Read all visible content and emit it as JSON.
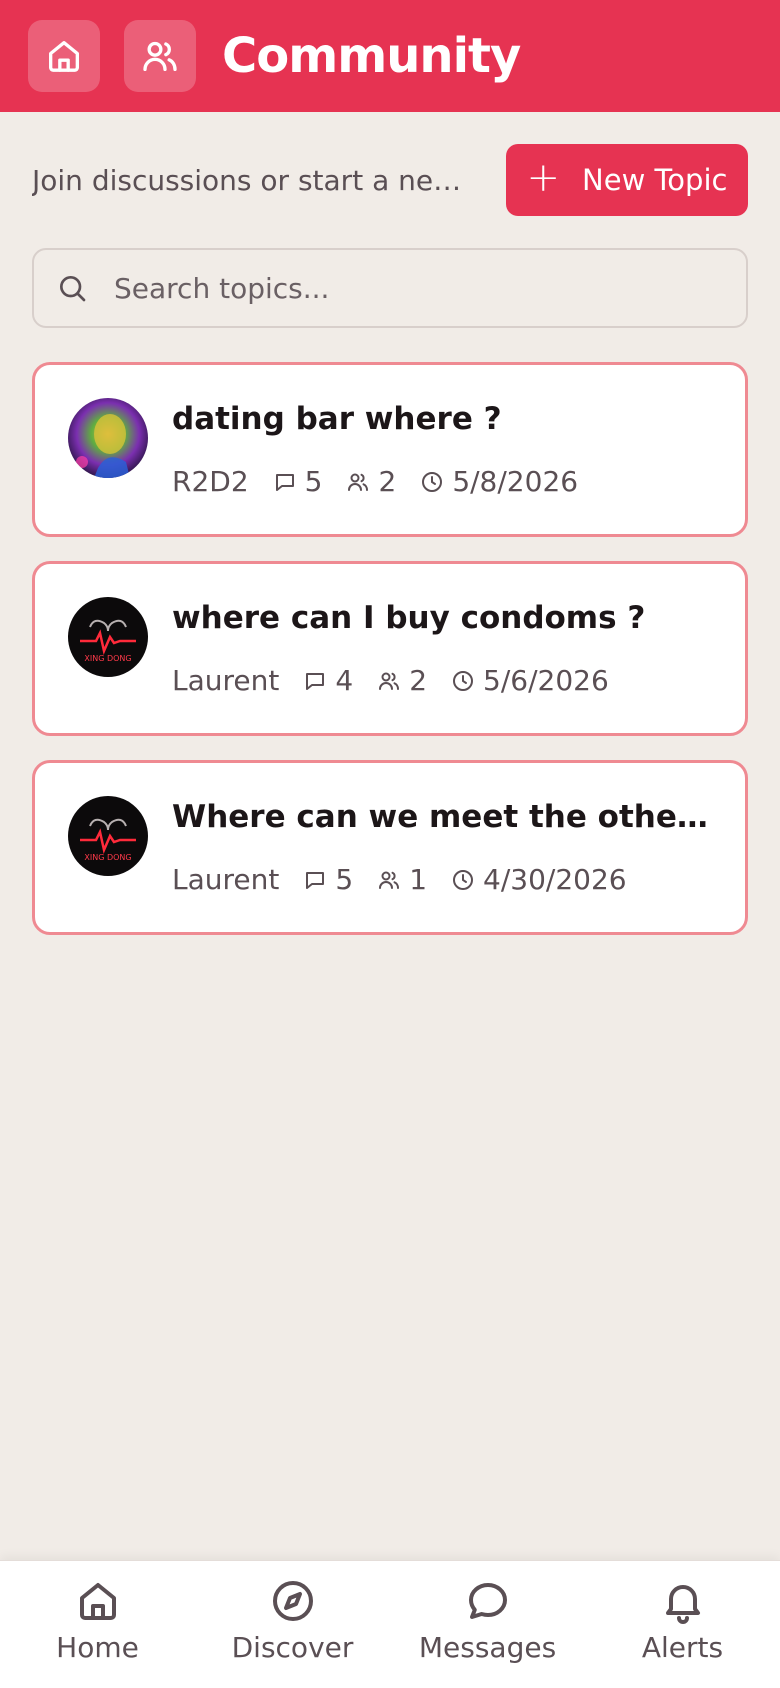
{
  "header": {
    "title": "Community",
    "accent": "#e63352",
    "home_icon": "home-icon",
    "users_icon": "users-icon"
  },
  "subheader": {
    "description": "Join discussions or start a new topic",
    "new_topic_label": "New Topic"
  },
  "search": {
    "placeholder": "Search topics..."
  },
  "topics": [
    {
      "title": "dating bar where ?",
      "author": "R2D2",
      "comments": "5",
      "participants": "2",
      "date": "5/8/2026"
    },
    {
      "title": "where can I buy condoms ?",
      "author": "Laurent",
      "comments": "4",
      "participants": "2",
      "date": "5/6/2026"
    },
    {
      "title": "Where can we meet the other members?",
      "author": "Laurent",
      "comments": "5",
      "participants": "1",
      "date": "4/30/2026"
    }
  ],
  "bottom_nav": [
    {
      "label": "Home",
      "icon": "home-icon"
    },
    {
      "label": "Discover",
      "icon": "compass-icon"
    },
    {
      "label": "Messages",
      "icon": "chat-bubble-icon"
    },
    {
      "label": "Alerts",
      "icon": "bell-icon"
    }
  ]
}
